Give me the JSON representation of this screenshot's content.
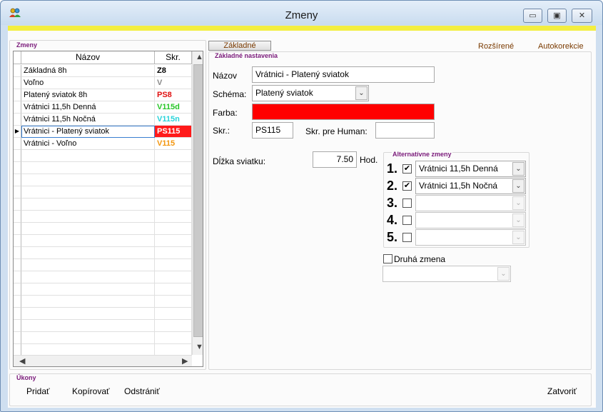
{
  "window": {
    "title": "Zmeny",
    "minimize_glyph": "▭",
    "maximize_glyph": "▣",
    "close_glyph": "✕"
  },
  "shifts_group": {
    "label": "Zmeny",
    "columns": {
      "name": "Názov",
      "code": "Skr."
    },
    "rows": [
      {
        "name": "Základná 8h",
        "code": "Z8",
        "color": "#000000",
        "bg": "#ffffff"
      },
      {
        "name": "Voľno",
        "code": "V",
        "color": "#8a8a8a",
        "bg": "#ffffff"
      },
      {
        "name": "Platený sviatok 8h",
        "code": "PS8",
        "color": "#e01010",
        "bg": "#ffffff"
      },
      {
        "name": "Vrátnici 11,5h Denná",
        "code": "V115d",
        "color": "#28c628",
        "bg": "#ffffff"
      },
      {
        "name": "Vrátnici 11,5h Nočná",
        "code": "V115n",
        "color": "#27d3d9",
        "bg": "#ffffff"
      },
      {
        "name": "Vrátnici - Platený sviatok",
        "code": "PS115",
        "color": "#ffffff",
        "bg": "#ff1a1a",
        "selected": true
      },
      {
        "name": "Vrátnici - Voľno",
        "code": "V115",
        "color": "#f3960e",
        "bg": "#ffffff"
      }
    ],
    "selected_marker": "▶"
  },
  "tabs": {
    "basic": "Základné",
    "extended": "Rozšírené",
    "autocorrection": "Autokorekcie"
  },
  "basic_settings": {
    "label": "Základné nastavenia",
    "name_label": "Názov",
    "name_value": "Vrátnici - Platený sviatok",
    "scheme_label": "Schéma:",
    "scheme_value": "Platený sviatok",
    "color_label": "Farba:",
    "color_value": "#ff0000",
    "code_label": "Skr.:",
    "code_value": "PS115",
    "human_code_label": "Skr. pre Human:",
    "human_code_value": "",
    "holiday_length_label": "Dĺžka sviatku:",
    "holiday_length_value": "7.50",
    "holiday_length_unit": "Hod."
  },
  "alternative_shifts": {
    "label": "Alternatívne zmeny",
    "items": [
      {
        "number": "1.",
        "checked": true,
        "value": "Vrátnici 11,5h Denná"
      },
      {
        "number": "2.",
        "checked": true,
        "value": "Vrátnici 11,5h Nočná"
      },
      {
        "number": "3.",
        "checked": false,
        "value": ""
      },
      {
        "number": "4.",
        "checked": false,
        "value": ""
      },
      {
        "number": "5.",
        "checked": false,
        "value": ""
      }
    ]
  },
  "second_shift": {
    "label": "Druhá zmena",
    "checked": false,
    "value": ""
  },
  "actions": {
    "label": "Úkony",
    "add": "Pridať",
    "copy": "Kopírovať",
    "remove": "Odstrániť",
    "close": "Zatvoriť"
  }
}
